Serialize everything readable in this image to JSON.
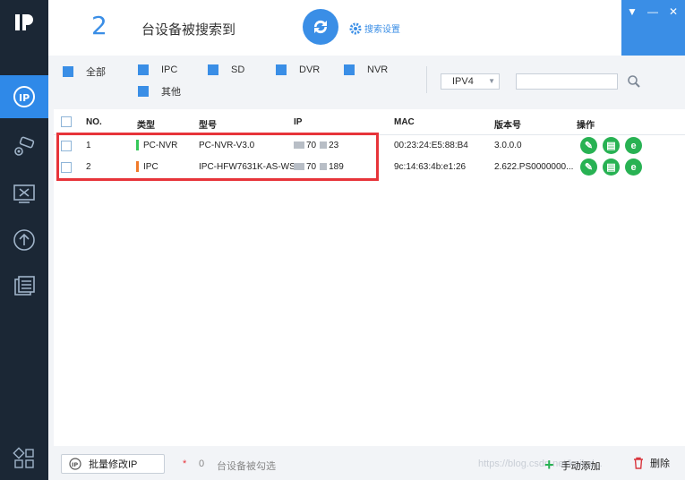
{
  "header": {
    "device_count": "2",
    "count_label": "台设备被搜索到",
    "search_settings": "搜索设置"
  },
  "filters": {
    "items": [
      {
        "label": "全部",
        "checked": true
      },
      {
        "label": "IPC",
        "checked": true
      },
      {
        "label": "SD",
        "checked": true
      },
      {
        "label": "DVR",
        "checked": true
      },
      {
        "label": "NVR",
        "checked": true
      },
      {
        "label": "其他",
        "checked": true
      }
    ],
    "ip_version": "IPV4",
    "search_value": ""
  },
  "table": {
    "columns": [
      "NO.",
      "类型",
      "型号",
      "IP",
      "MAC",
      "版本号",
      "操作"
    ],
    "rows": [
      {
        "no": "1",
        "type": "PC-NVR",
        "type_color": "#36c85a",
        "model": "PC-NVR-V3.0",
        "ip_a": "70",
        "ip_b": "23",
        "mac": "00:23:24:E5:88:B4",
        "version": "3.0.0.0"
      },
      {
        "no": "2",
        "type": "IPC",
        "type_color": "#f07a2a",
        "model": "IPC-HFW7631K-AS-WS",
        "ip_a": "70",
        "ip_b": "189",
        "mac": "9c:14:63:4b:e1:26",
        "version": "2.622.PS0000000..."
      }
    ]
  },
  "bottom": {
    "batch_button": "批量修改IP",
    "star": "*",
    "selected_count": "0",
    "selected_label": "台设备被勾选",
    "add_button": "手动添加",
    "delete_button": "删除",
    "watermark": "https://blog.csdn.net/kaikai..."
  },
  "colors": {
    "accent": "#3a8ee6",
    "sidebar": "#1b2735",
    "highlight": "#e7343a",
    "action_green": "#28b253"
  }
}
